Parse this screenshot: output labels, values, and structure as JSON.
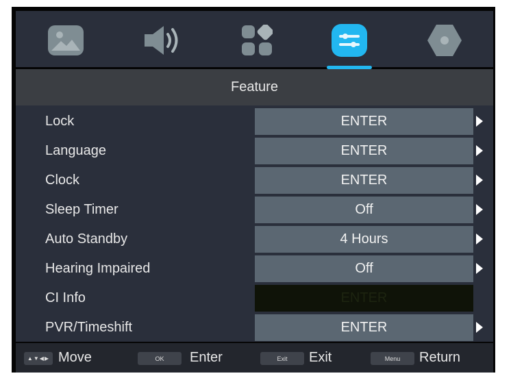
{
  "header": {
    "tabs": [
      {
        "icon": "picture-icon",
        "active": false
      },
      {
        "icon": "sound-icon",
        "active": false
      },
      {
        "icon": "channel-icon",
        "active": false
      },
      {
        "icon": "feature-icon",
        "active": true
      },
      {
        "icon": "setup-icon",
        "active": false
      }
    ],
    "accent_color": "#22b7f0"
  },
  "title": "Feature",
  "rows": [
    {
      "label": "Lock",
      "value": "ENTER",
      "enabled": true
    },
    {
      "label": "Language",
      "value": "ENTER",
      "enabled": true
    },
    {
      "label": "Clock",
      "value": "ENTER",
      "enabled": true
    },
    {
      "label": "Sleep Timer",
      "value": "Off",
      "enabled": true
    },
    {
      "label": "Auto Standby",
      "value": "4 Hours",
      "enabled": true
    },
    {
      "label": "Hearing Impaired",
      "value": "Off",
      "enabled": true
    },
    {
      "label": "CI Info",
      "value": "ENTER",
      "enabled": false
    },
    {
      "label": "PVR/Timeshift",
      "value": "ENTER",
      "enabled": true
    }
  ],
  "footer": {
    "move_key": "▲▼◀▶",
    "move_label": "Move",
    "ok_key": "OK",
    "ok_label": "Enter",
    "exit_key": "Exit",
    "exit_label": "Exit",
    "menu_key": "Menu",
    "menu_label": "Return"
  }
}
